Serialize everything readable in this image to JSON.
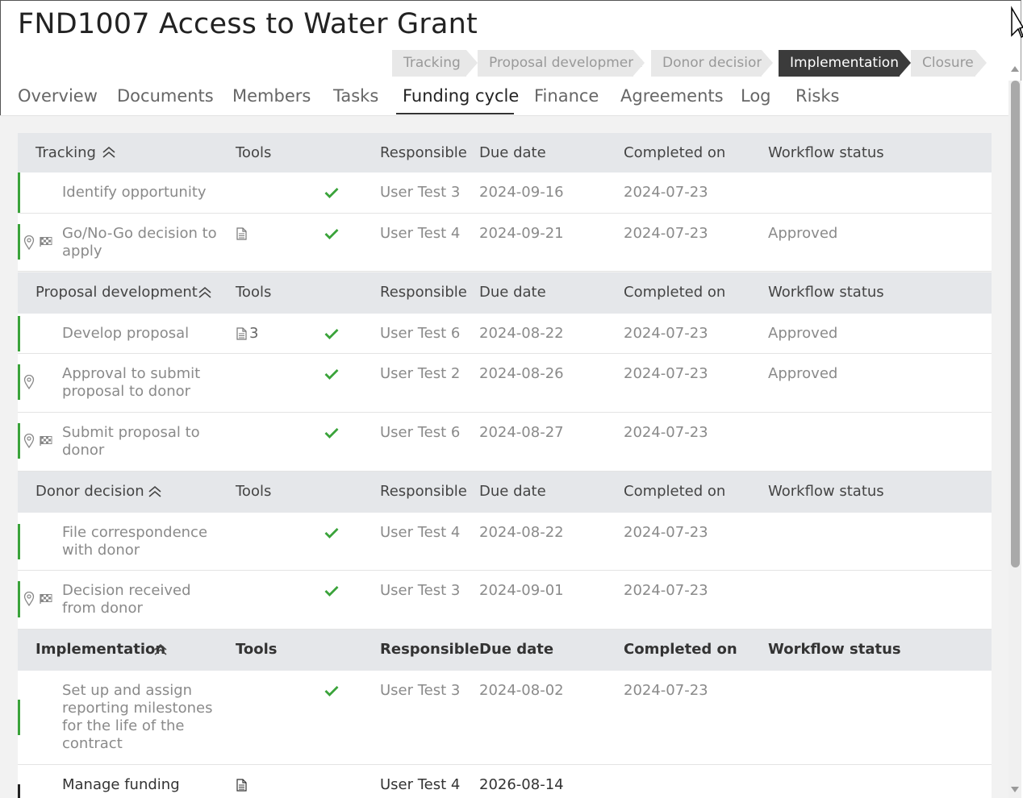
{
  "page": {
    "title": "FND1007 Access to Water Grant"
  },
  "stages": [
    {
      "label": "Tracking",
      "active": false
    },
    {
      "label": "Proposal development",
      "active": false
    },
    {
      "label": "Donor decision",
      "active": false
    },
    {
      "label": "Implementation",
      "active": true
    },
    {
      "label": "Closure",
      "active": false
    }
  ],
  "tabs": [
    {
      "label": "Overview"
    },
    {
      "label": "Documents"
    },
    {
      "label": "Members"
    },
    {
      "label": "Tasks"
    },
    {
      "label": "Funding cycle",
      "active": true
    },
    {
      "label": "Finance"
    },
    {
      "label": "Agreements"
    },
    {
      "label": "Log"
    },
    {
      "label": "Risks"
    }
  ],
  "columns": {
    "tools": "Tools",
    "responsible": "Responsible",
    "due_date": "Due date",
    "completed_on": "Completed on",
    "workflow_status": "Workflow status"
  },
  "sections": [
    {
      "name": "Tracking",
      "tasks": [
        {
          "name": "Identify opportunity",
          "completed": true,
          "responsible": "User Test 3",
          "due": "2024-09-16",
          "completed_on": "2024-07-23",
          "status": ""
        },
        {
          "name": "Go/No-Go decision to apply",
          "doc": true,
          "completed": true,
          "responsible": "User Test 4",
          "due": "2024-09-21",
          "completed_on": "2024-07-23",
          "status": "Approved",
          "pin": true,
          "flag": true
        }
      ]
    },
    {
      "name": "Proposal development",
      "tasks": [
        {
          "name": "Develop proposal",
          "doc": true,
          "doc_count": "3",
          "completed": true,
          "responsible": "User Test 6",
          "due": "2024-08-22",
          "completed_on": "2024-07-23",
          "status": "Approved"
        },
        {
          "name": "Approval to submit proposal to donor",
          "completed": true,
          "responsible": "User Test 2",
          "due": "2024-08-26",
          "completed_on": "2024-07-23",
          "status": "Approved",
          "pin": true
        },
        {
          "name": "Submit proposal to donor",
          "completed": true,
          "responsible": "User Test 6",
          "due": "2024-08-27",
          "completed_on": "2024-07-23",
          "status": "",
          "pin": true,
          "flag": true
        }
      ]
    },
    {
      "name": "Donor decision",
      "tasks": [
        {
          "name": "File correspondence with donor",
          "completed": true,
          "responsible": "User Test 4",
          "due": "2024-08-22",
          "completed_on": "2024-07-23",
          "status": ""
        },
        {
          "name": "Decision received from donor",
          "completed": true,
          "responsible": "User Test 3",
          "due": "2024-09-01",
          "completed_on": "2024-07-23",
          "status": "",
          "pin": true,
          "flag": true
        }
      ]
    },
    {
      "name": "Implementation",
      "tasks": [
        {
          "name": "Set up and assign reporting milestones for the life of the contract",
          "completed": true,
          "responsible": "User Test 3",
          "due": "2024-08-02",
          "completed_on": "2024-07-23",
          "status": ""
        },
        {
          "name": "Manage funding",
          "doc": true,
          "completed": false,
          "responsible": "User Test 4",
          "due": "2026-08-14",
          "completed_on": "",
          "status": ""
        }
      ]
    }
  ],
  "colors": {
    "accent_green": "#3aa33a",
    "active_stage": "#3b3b3b",
    "section_bg": "#e5e7ea"
  },
  "icons": {
    "sort": "chevron-double-up-icon",
    "check": "checkmark-icon",
    "doc": "document-icon",
    "pin": "location-pin-icon",
    "flag": "checkered-flag-icon"
  }
}
